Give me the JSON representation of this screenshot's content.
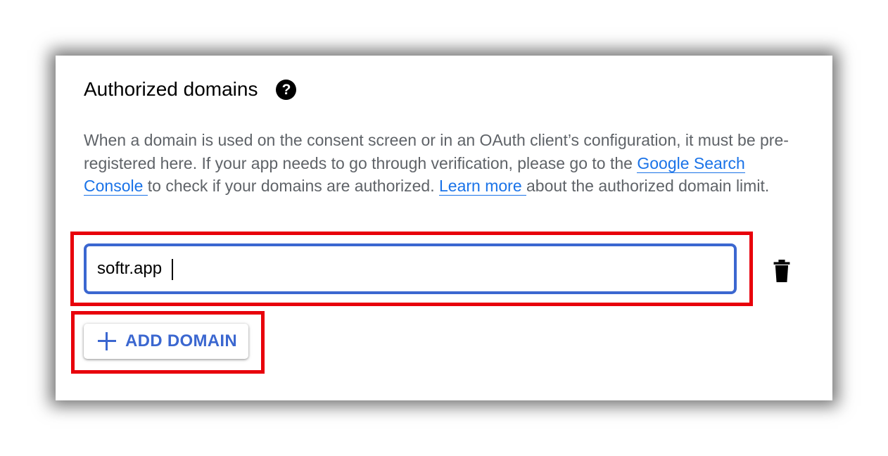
{
  "section": {
    "title": "Authorized domains",
    "help_icon": "help-icon",
    "description": {
      "part1": "When a domain is used on the consent screen or in an OAuth client’s configuration, it must be pre-registered here. If your app needs to go through verification, please go to the ",
      "link1": "Google Search Console ",
      "part2": "to check if your domains are authorized. ",
      "link2": "Learn more ",
      "part3": "about the authorized domain limit."
    }
  },
  "domains": [
    {
      "value": "softr.app",
      "delete_icon": "trash-icon"
    }
  ],
  "add_button": {
    "icon": "plus-icon",
    "label": "ADD DOMAIN"
  },
  "colors": {
    "accent": "#3b67d0",
    "link": "#1a73e8",
    "highlight": "#e8000b",
    "text_secondary": "#5f6368"
  }
}
